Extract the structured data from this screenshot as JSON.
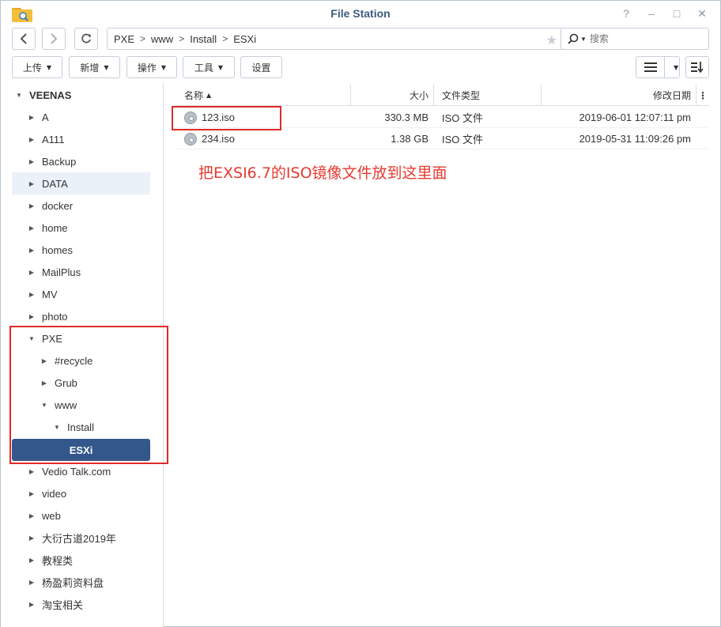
{
  "window": {
    "title": "File Station"
  },
  "window_controls": {
    "help": "?",
    "minimize": "–",
    "maximize": "□",
    "close": "✕"
  },
  "path": [
    "PXE",
    "www",
    "Install",
    "ESXi"
  ],
  "search": {
    "placeholder": "搜索"
  },
  "toolbar": {
    "upload": "上传",
    "create": "新增",
    "action": "操作",
    "tools": "工具",
    "settings": "设置"
  },
  "sidebar": {
    "root": "VEENAS",
    "items": [
      {
        "label": "A"
      },
      {
        "label": "A111"
      },
      {
        "label": "Backup"
      },
      {
        "label": "DATA"
      },
      {
        "label": "docker"
      },
      {
        "label": "home"
      },
      {
        "label": "homes"
      },
      {
        "label": "MailPlus"
      },
      {
        "label": "MV"
      },
      {
        "label": "photo"
      },
      {
        "label": "PXE"
      },
      {
        "label": "#recycle"
      },
      {
        "label": "Grub"
      },
      {
        "label": "www"
      },
      {
        "label": "Install"
      },
      {
        "label": "ESXi"
      },
      {
        "label": "Vedio Talk.com"
      },
      {
        "label": "video"
      },
      {
        "label": "web"
      },
      {
        "label": "大衍古道2019年"
      },
      {
        "label": "教程类"
      },
      {
        "label": "杨盈莉资料盘"
      },
      {
        "label": "淘宝相关"
      }
    ]
  },
  "filelist": {
    "columns": {
      "name": "名称",
      "size": "大小",
      "type": "文件类型",
      "modified": "修改日期"
    },
    "files": [
      {
        "name": "123.iso",
        "size": "330.3 MB",
        "type": "ISO 文件",
        "modified": "2019-06-01 12:07:11 pm"
      },
      {
        "name": "234.iso",
        "size": "1.38 GB",
        "type": "ISO 文件",
        "modified": "2019-05-31 11:09:26 pm"
      }
    ]
  },
  "annotation": "把EXSI6.7的ISO镜像文件放到这里面",
  "colors": {
    "accent": "#34578b",
    "annotation": "#e63a2f",
    "highlight_box": "#e02a2a"
  }
}
